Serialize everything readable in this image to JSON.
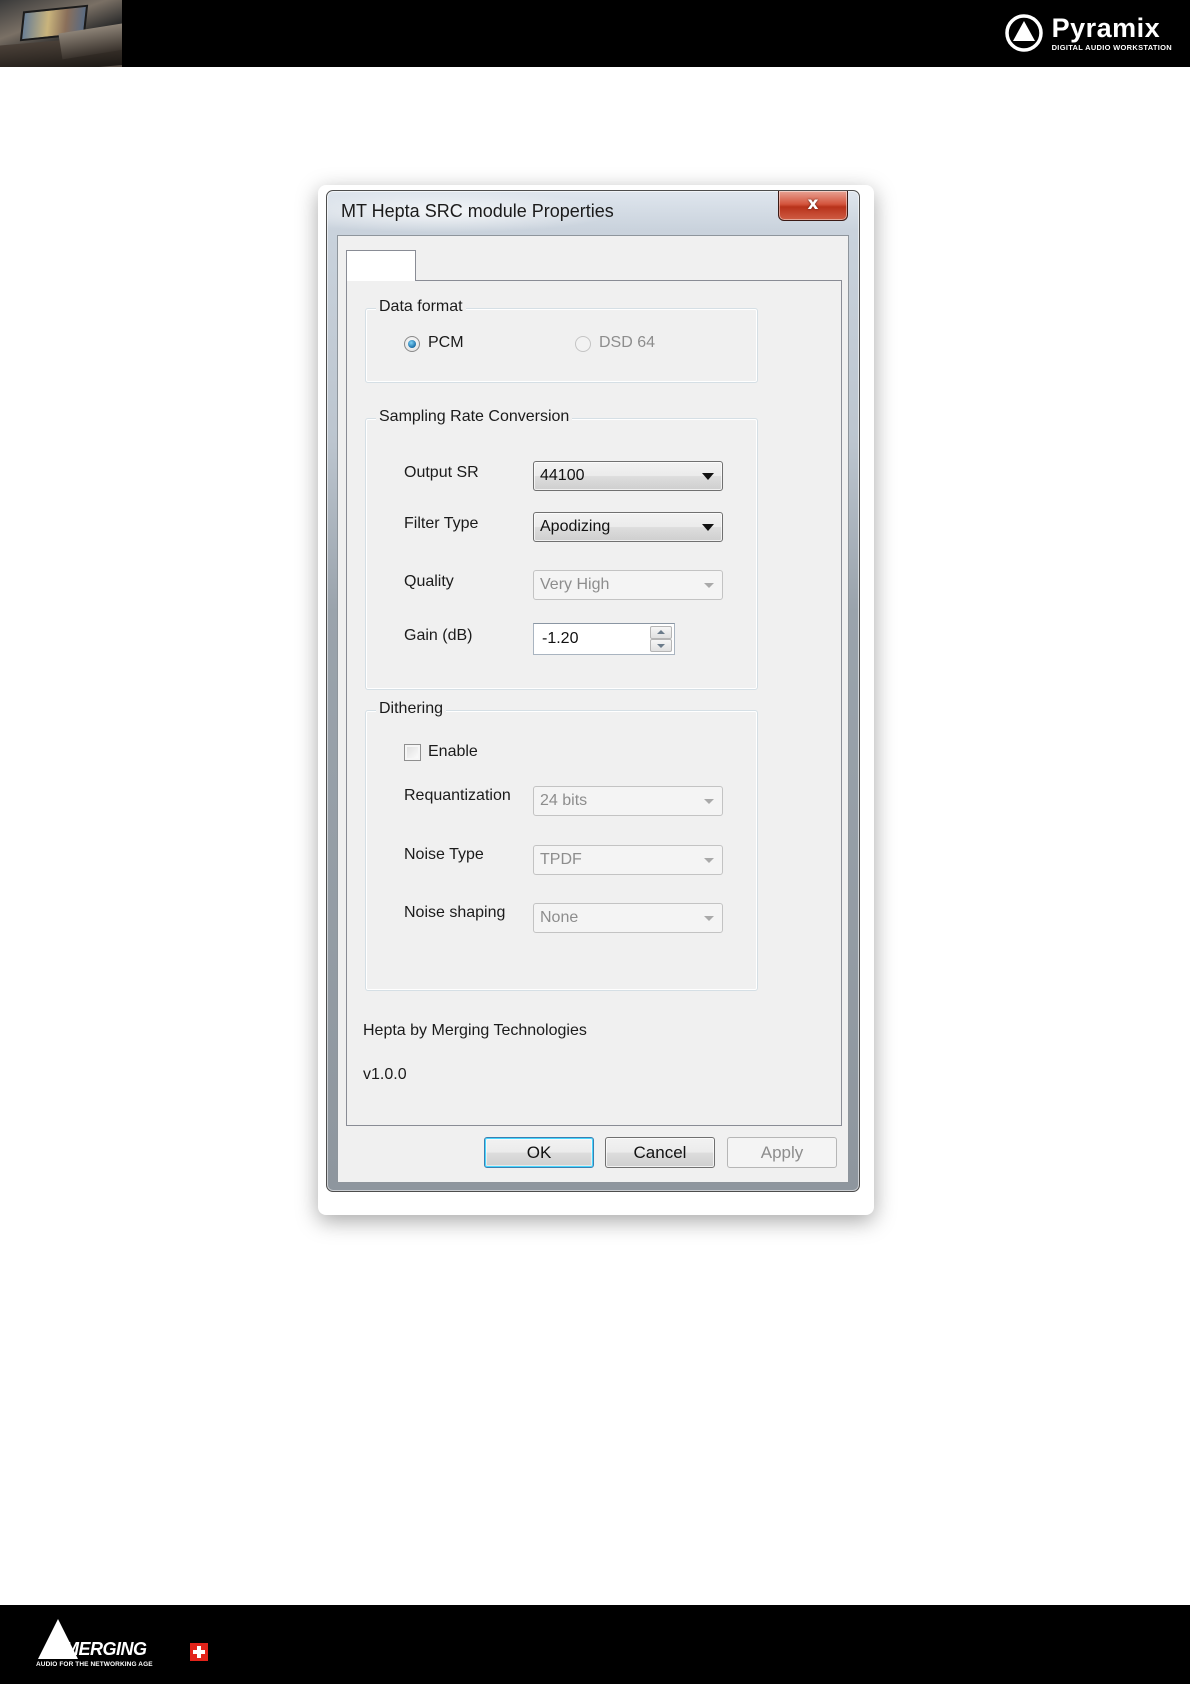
{
  "header": {
    "brand_name": "Pyramix",
    "brand_sub": "DIGITAL AUDIO WORKSTATION"
  },
  "dialog": {
    "title": "MT Hepta SRC module Properties",
    "close_glyph": "x",
    "data_format": {
      "label": "Data format",
      "options": [
        "PCM",
        "DSD 64"
      ],
      "selected": "PCM"
    },
    "src": {
      "label": "Sampling Rate Conversion",
      "output_sr_label": "Output SR",
      "output_sr_value": "44100",
      "filter_type_label": "Filter Type",
      "filter_type_value": "Apodizing",
      "quality_label": "Quality",
      "quality_value": "Very High",
      "gain_label": "Gain (dB)",
      "gain_value": "-1.20"
    },
    "dithering": {
      "label": "Dithering",
      "enable_label": "Enable",
      "enable_checked": false,
      "requant_label": "Requantization",
      "requant_value": "24 bits",
      "noise_type_label": "Noise Type",
      "noise_type_value": "TPDF",
      "noise_shaping_label": "Noise shaping",
      "noise_shaping_value": "None"
    },
    "info": {
      "credit": "Hepta by Merging Technologies",
      "version": "v1.0.0"
    },
    "buttons": {
      "ok": "OK",
      "cancel": "Cancel",
      "apply": "Apply"
    }
  },
  "footer": {
    "brand_name": "MERGING",
    "tagline": "AUDIO FOR THE NETWORKING AGE"
  },
  "colors": {
    "page_bar": "#000000",
    "close_button": "#c7452d",
    "swiss_red": "#e2231a",
    "focus_blue": "#3c7fb1"
  }
}
